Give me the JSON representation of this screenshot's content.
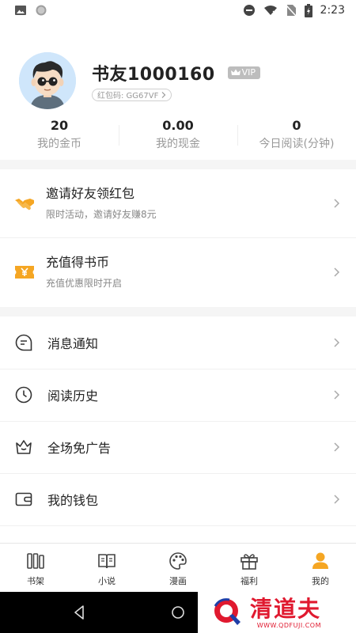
{
  "status_bar": {
    "time": "2:23"
  },
  "profile": {
    "username": "书友1000160",
    "vip_label": "VIP",
    "code_label": "红包码: GG67VF"
  },
  "stats": [
    {
      "value": "20",
      "label": "我的金币"
    },
    {
      "value": "0.00",
      "label": "我的现金"
    },
    {
      "value": "0",
      "label": "今日阅读(分钟)"
    }
  ],
  "promos": [
    {
      "title": "邀请好友领红包",
      "subtitle": "限时活动，邀请好友赚8元",
      "icon": "handshake-icon"
    },
    {
      "title": "充值得书币",
      "subtitle": "充值优惠限时开启",
      "icon": "coupon-yen-icon"
    }
  ],
  "menu": [
    {
      "label": "消息通知",
      "icon": "message-icon"
    },
    {
      "label": "阅读历史",
      "icon": "clock-icon"
    },
    {
      "label": "全场免广告",
      "icon": "crown-icon"
    },
    {
      "label": "我的钱包",
      "icon": "wallet-icon"
    }
  ],
  "tabs": [
    {
      "label": "书架",
      "icon": "bookshelf-icon"
    },
    {
      "label": "小说",
      "icon": "book-open-icon"
    },
    {
      "label": "漫画",
      "icon": "palette-icon"
    },
    {
      "label": "福利",
      "icon": "gift-icon"
    },
    {
      "label": "我的",
      "icon": "person-icon",
      "active": true
    }
  ],
  "watermark": {
    "title": "清道夫",
    "url": "WWW.QDFUJI.COM"
  },
  "colors": {
    "accent": "#f5a623",
    "watermark": "#e0192f",
    "text": "#222222",
    "subtext": "#999999"
  }
}
